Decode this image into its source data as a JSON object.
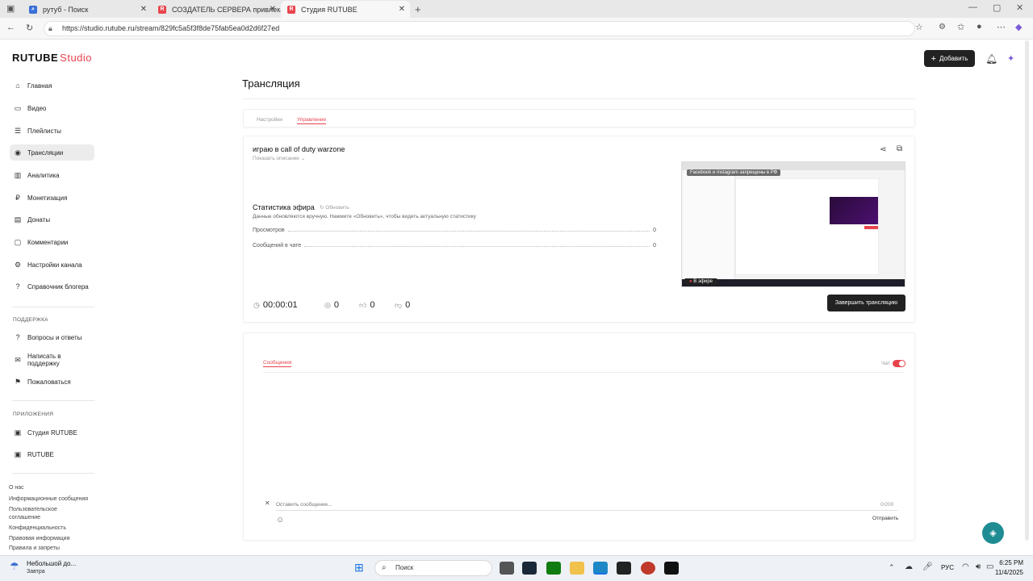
{
  "browser": {
    "tabs": [
      {
        "title": "рутуб - Поиск"
      },
      {
        "title": "СОЗДАТЕЛЬ СЕРВЕРА привлекаю"
      },
      {
        "title": "Студия RUTUBE"
      }
    ],
    "url": "https://studio.rutube.ru/stream/829fc5a5f3f8de75fab5ea0d2d6f27ed"
  },
  "logo": {
    "brand": "RUTUBE",
    "product": "Studio"
  },
  "header": {
    "add_button": "Добавить"
  },
  "sidebar": {
    "items": [
      {
        "label": "Главная",
        "icon": "home-icon"
      },
      {
        "label": "Видео",
        "icon": "video-icon"
      },
      {
        "label": "Плейлисты",
        "icon": "playlist-icon"
      },
      {
        "label": "Трансляции",
        "icon": "broadcast-icon"
      },
      {
        "label": "Аналитика",
        "icon": "analytics-icon"
      },
      {
        "label": "Монетизация",
        "icon": "money-icon"
      },
      {
        "label": "Донаты",
        "icon": "donate-icon"
      },
      {
        "label": "Комментарии",
        "icon": "comment-icon"
      },
      {
        "label": "Настройки канала",
        "icon": "gear-icon"
      },
      {
        "label": "Справочник блогера",
        "icon": "help-icon"
      }
    ],
    "support_heading": "ПОДДЕРЖКА",
    "support": [
      {
        "label": "Вопросы и ответы"
      },
      {
        "label": "Написать в поддержку"
      },
      {
        "label": "Пожаловаться"
      }
    ],
    "apps_heading": "ПРИЛОЖЕНИЯ",
    "apps": [
      {
        "label": "Студия RUTUBE"
      },
      {
        "label": "RUTUBE"
      }
    ],
    "footer": [
      "О нас",
      "Информационные сообщения",
      "Пользовательское",
      "соглашение",
      "Конфиденциальность",
      "Правовая информация",
      "Правила и запреты"
    ]
  },
  "page": {
    "title": "Трансляция",
    "tabs": [
      "Настройки",
      "Управление"
    ]
  },
  "stream": {
    "title": "играю в call of duty warzone",
    "show_description": "Показать описание",
    "stats_title": "Статистика эфира",
    "refresh": "Обновить",
    "stats_note": "Данные обновляются вручную. Нажмите «Обновить», чтобы видеть актуальную статистику",
    "views_label": "Просмотров",
    "views_value": "0",
    "chat_msgs_label": "Сообщений в чате",
    "chat_msgs_value": "0",
    "duration": "00:00:01",
    "viewers": "0",
    "likes": "0",
    "dislikes": "0",
    "end_button": "Завершить трансляцию",
    "preview_banner": "Facebook и Instagram запрещены в РФ",
    "live_badge": "В эфире"
  },
  "chat": {
    "tab": "Сообщения",
    "toggle_label": "Чат",
    "toggle_on": true,
    "placeholder": "Оставить сообщение...",
    "counter": "0/200",
    "send": "Отправить"
  },
  "taskbar": {
    "weather_title": "Небольшой до...",
    "weather_sub": "Завтра",
    "search": "Поиск",
    "lang": "РУС",
    "time": "6:25 PM",
    "date": "11/4/2025"
  },
  "colors": {
    "accent": "#e8444e",
    "dark": "#222222"
  }
}
